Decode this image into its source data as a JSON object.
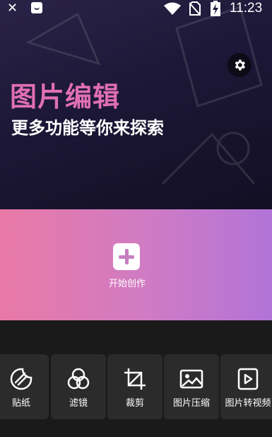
{
  "status_bar": {
    "time": "11:23",
    "icons": [
      "close-icon",
      "app-notification-icon",
      "wifi-icon",
      "no-sim-icon",
      "battery-charging-icon"
    ]
  },
  "header": {
    "title": "图片编辑",
    "subtitle": "更多功能等你来探索",
    "settings_icon": "gear-icon"
  },
  "create": {
    "label": "开始创作",
    "icon": "plus-icon"
  },
  "tools": [
    {
      "label": "贴纸",
      "icon": "sticker-icon"
    },
    {
      "label": "滤镜",
      "icon": "filter-icon"
    },
    {
      "label": "裁剪",
      "icon": "crop-icon"
    },
    {
      "label": "图片压缩",
      "icon": "image-icon"
    },
    {
      "label": "图片转视频",
      "icon": "video-icon"
    }
  ],
  "colors": {
    "title_pink": "#e06fb2",
    "gradient_start": "#e979a6",
    "gradient_end": "#b274d8",
    "card_bg": "#2b2b2b"
  }
}
